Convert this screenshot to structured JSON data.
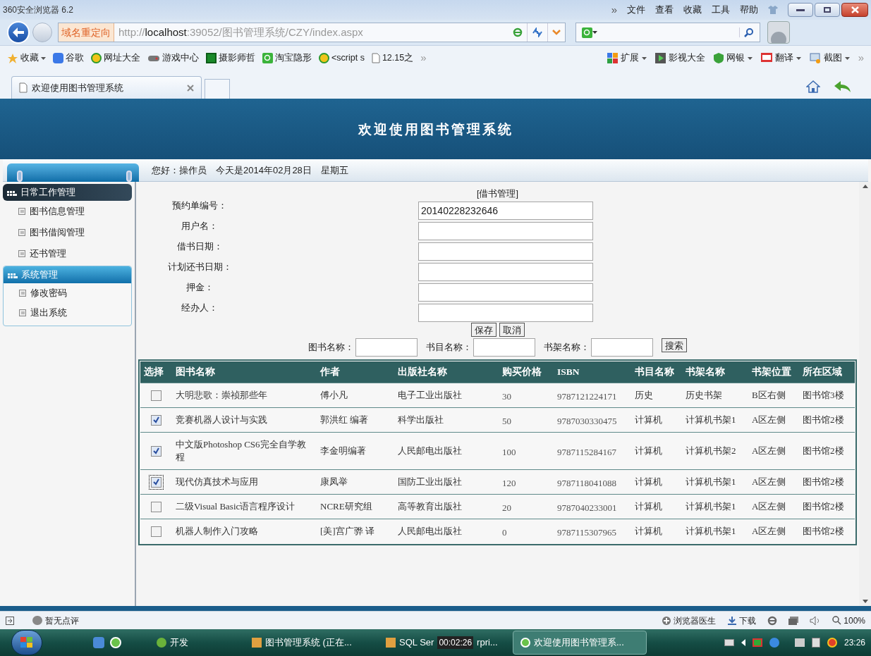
{
  "browser": {
    "title": "360安全浏览器 6.2",
    "more": "»",
    "menu": [
      "文件",
      "查看",
      "收藏",
      "工具",
      "帮助"
    ],
    "redirect_badge": "域名重定向",
    "url_parts": [
      {
        "text": "http://",
        "emphasis": false
      },
      {
        "text": "localhost",
        "emphasis": true
      },
      {
        "text": ":39052/图书管理系统/CZY/index.aspx",
        "emphasis": false
      }
    ],
    "bookmarks": [
      {
        "label": "收藏",
        "has_menu": true
      },
      {
        "label": "谷歌",
        "has_menu": false
      },
      {
        "label": "网址大全",
        "has_menu": false
      },
      {
        "label": "游戏中心",
        "has_menu": false
      },
      {
        "label": "摄影师哲",
        "has_menu": false
      },
      {
        "label": "淘宝隐形",
        "has_menu": false
      },
      {
        "label": "<script s",
        "has_menu": false
      },
      {
        "label": "12.15之",
        "has_menu": false
      }
    ],
    "bookmarks_more": "»",
    "extensions": [
      {
        "label": "扩展",
        "has_menu": true
      },
      {
        "label": "影视大全",
        "has_menu": false
      },
      {
        "label": "网银",
        "has_menu": true
      },
      {
        "label": "翻译",
        "has_menu": true
      },
      {
        "label": "截图",
        "has_menu": true
      }
    ],
    "extensions_more": "»",
    "tabs": [
      {
        "label": "欢迎使用图书管理系统",
        "selected": true
      }
    ]
  },
  "page": {
    "banner_title": "欢迎使用图书管理系统",
    "greeting": "您好：操作员　今天是2014年02月28日　星期五",
    "sidebar": [
      {
        "title": "日常工作管理",
        "kind": "dark",
        "items": [
          "图书信息管理",
          "图书借阅管理",
          "还书管理"
        ]
      },
      {
        "title": "系统管理",
        "kind": "light",
        "items": [
          "修改密码",
          "退出系统"
        ]
      }
    ],
    "form": {
      "title": "[借书管理]",
      "fields": [
        {
          "label": "预约单编号：",
          "value": "20140228232646"
        },
        {
          "label": "用户名："
        },
        {
          "label": "借书日期："
        },
        {
          "label": "计划还书日期："
        },
        {
          "label": "押金："
        },
        {
          "label": "经办人："
        }
      ],
      "buttons": [
        "保存",
        "取消"
      ]
    },
    "search": {
      "fields": [
        "图书名称：",
        "书目名称：",
        "书架名称："
      ],
      "button": "搜索"
    },
    "table": {
      "select_column": "选择",
      "columns": [
        "图书名称",
        "作者",
        "出版社名称",
        "购买价格",
        "ISBN",
        "书目名称",
        "书架名称",
        "书架位置",
        "所在区域"
      ],
      "rows": [
        {
          "checked": false,
          "focused": false,
          "cells": [
            "大明悲歌：崇祯那些年",
            "傅小凡",
            "电子工业出版社",
            "30",
            "9787121224171",
            "历史",
            "历史书架",
            "B区右侧",
            "图书馆3楼"
          ]
        },
        {
          "checked": true,
          "focused": false,
          "cells": [
            "竞赛机器人设计与实践",
            "郭洪红  编著",
            "科学出版社",
            "50",
            "9787030330475",
            "计算机",
            "计算机书架1",
            "A区左侧",
            "图书馆2楼"
          ]
        },
        {
          "checked": true,
          "focused": false,
          "cells": [
            "中文版Photoshop CS6完全自学教程",
            "李金明编著",
            "人民邮电出版社",
            "100",
            "9787115284167",
            "计算机",
            "计算机书架2",
            "A区左侧",
            "图书馆2楼"
          ]
        },
        {
          "checked": true,
          "focused": true,
          "cells": [
            "现代仿真技术与应用",
            "康凤举",
            "国防工业出版社",
            "120",
            "9787118041088",
            "计算机",
            "计算机书架1",
            "A区左侧",
            "图书馆2楼"
          ]
        },
        {
          "checked": false,
          "focused": false,
          "cells": [
            "二级Visual Basic语言程序设计",
            "NCRE研究组",
            "高等教育出版社",
            "20",
            "9787040233001",
            "计算机",
            "计算机书架1",
            "A区左侧",
            "图书馆2楼"
          ]
        },
        {
          "checked": false,
          "focused": false,
          "cells": [
            "机器人制作入门攻略",
            "[美]宫广骅   译",
            "人民邮电出版社",
            "0",
            "9787115307965",
            "计算机",
            "计算机书架1",
            "A区左侧",
            "图书馆2楼"
          ]
        }
      ]
    }
  },
  "status_bar": {
    "rating": "暂无点评",
    "tools": [
      "浏览器医生",
      "下载"
    ],
    "zoom": "100%"
  },
  "taskbar": {
    "items": [
      {
        "label": "开发",
        "selected": false
      },
      {
        "label": "图书管理系统 (正在...",
        "selected": false
      },
      {
        "label": "SQL Ser",
        "label_end": "rpri...",
        "covered": true,
        "selected": false
      },
      {
        "label": "欢迎使用图书管理系...",
        "selected": true
      }
    ],
    "clock": "23:26",
    "recording_timer": "00:02:26"
  }
}
